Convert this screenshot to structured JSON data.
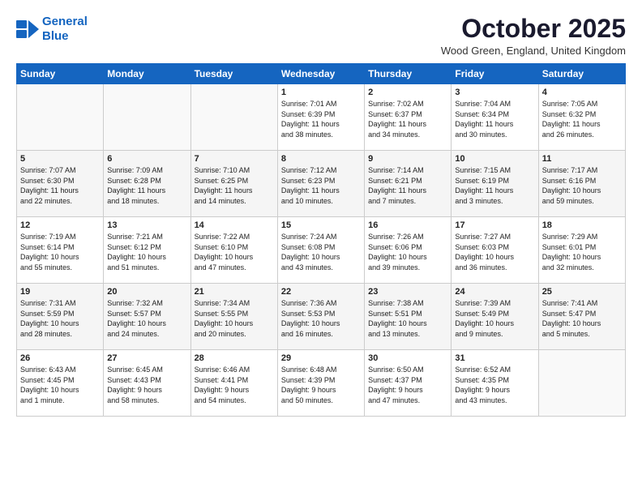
{
  "logo": {
    "text_general": "General",
    "text_blue": "Blue"
  },
  "title": "October 2025",
  "location": "Wood Green, England, United Kingdom",
  "weekdays": [
    "Sunday",
    "Monday",
    "Tuesday",
    "Wednesday",
    "Thursday",
    "Friday",
    "Saturday"
  ],
  "weeks": [
    [
      {
        "day": "",
        "info": ""
      },
      {
        "day": "",
        "info": ""
      },
      {
        "day": "",
        "info": ""
      },
      {
        "day": "1",
        "info": "Sunrise: 7:01 AM\nSunset: 6:39 PM\nDaylight: 11 hours\nand 38 minutes."
      },
      {
        "day": "2",
        "info": "Sunrise: 7:02 AM\nSunset: 6:37 PM\nDaylight: 11 hours\nand 34 minutes."
      },
      {
        "day": "3",
        "info": "Sunrise: 7:04 AM\nSunset: 6:34 PM\nDaylight: 11 hours\nand 30 minutes."
      },
      {
        "day": "4",
        "info": "Sunrise: 7:05 AM\nSunset: 6:32 PM\nDaylight: 11 hours\nand 26 minutes."
      }
    ],
    [
      {
        "day": "5",
        "info": "Sunrise: 7:07 AM\nSunset: 6:30 PM\nDaylight: 11 hours\nand 22 minutes."
      },
      {
        "day": "6",
        "info": "Sunrise: 7:09 AM\nSunset: 6:28 PM\nDaylight: 11 hours\nand 18 minutes."
      },
      {
        "day": "7",
        "info": "Sunrise: 7:10 AM\nSunset: 6:25 PM\nDaylight: 11 hours\nand 14 minutes."
      },
      {
        "day": "8",
        "info": "Sunrise: 7:12 AM\nSunset: 6:23 PM\nDaylight: 11 hours\nand 10 minutes."
      },
      {
        "day": "9",
        "info": "Sunrise: 7:14 AM\nSunset: 6:21 PM\nDaylight: 11 hours\nand 7 minutes."
      },
      {
        "day": "10",
        "info": "Sunrise: 7:15 AM\nSunset: 6:19 PM\nDaylight: 11 hours\nand 3 minutes."
      },
      {
        "day": "11",
        "info": "Sunrise: 7:17 AM\nSunset: 6:16 PM\nDaylight: 10 hours\nand 59 minutes."
      }
    ],
    [
      {
        "day": "12",
        "info": "Sunrise: 7:19 AM\nSunset: 6:14 PM\nDaylight: 10 hours\nand 55 minutes."
      },
      {
        "day": "13",
        "info": "Sunrise: 7:21 AM\nSunset: 6:12 PM\nDaylight: 10 hours\nand 51 minutes."
      },
      {
        "day": "14",
        "info": "Sunrise: 7:22 AM\nSunset: 6:10 PM\nDaylight: 10 hours\nand 47 minutes."
      },
      {
        "day": "15",
        "info": "Sunrise: 7:24 AM\nSunset: 6:08 PM\nDaylight: 10 hours\nand 43 minutes."
      },
      {
        "day": "16",
        "info": "Sunrise: 7:26 AM\nSunset: 6:06 PM\nDaylight: 10 hours\nand 39 minutes."
      },
      {
        "day": "17",
        "info": "Sunrise: 7:27 AM\nSunset: 6:03 PM\nDaylight: 10 hours\nand 36 minutes."
      },
      {
        "day": "18",
        "info": "Sunrise: 7:29 AM\nSunset: 6:01 PM\nDaylight: 10 hours\nand 32 minutes."
      }
    ],
    [
      {
        "day": "19",
        "info": "Sunrise: 7:31 AM\nSunset: 5:59 PM\nDaylight: 10 hours\nand 28 minutes."
      },
      {
        "day": "20",
        "info": "Sunrise: 7:32 AM\nSunset: 5:57 PM\nDaylight: 10 hours\nand 24 minutes."
      },
      {
        "day": "21",
        "info": "Sunrise: 7:34 AM\nSunset: 5:55 PM\nDaylight: 10 hours\nand 20 minutes."
      },
      {
        "day": "22",
        "info": "Sunrise: 7:36 AM\nSunset: 5:53 PM\nDaylight: 10 hours\nand 16 minutes."
      },
      {
        "day": "23",
        "info": "Sunrise: 7:38 AM\nSunset: 5:51 PM\nDaylight: 10 hours\nand 13 minutes."
      },
      {
        "day": "24",
        "info": "Sunrise: 7:39 AM\nSunset: 5:49 PM\nDaylight: 10 hours\nand 9 minutes."
      },
      {
        "day": "25",
        "info": "Sunrise: 7:41 AM\nSunset: 5:47 PM\nDaylight: 10 hours\nand 5 minutes."
      }
    ],
    [
      {
        "day": "26",
        "info": "Sunrise: 6:43 AM\nSunset: 4:45 PM\nDaylight: 10 hours\nand 1 minute."
      },
      {
        "day": "27",
        "info": "Sunrise: 6:45 AM\nSunset: 4:43 PM\nDaylight: 9 hours\nand 58 minutes."
      },
      {
        "day": "28",
        "info": "Sunrise: 6:46 AM\nSunset: 4:41 PM\nDaylight: 9 hours\nand 54 minutes."
      },
      {
        "day": "29",
        "info": "Sunrise: 6:48 AM\nSunset: 4:39 PM\nDaylight: 9 hours\nand 50 minutes."
      },
      {
        "day": "30",
        "info": "Sunrise: 6:50 AM\nSunset: 4:37 PM\nDaylight: 9 hours\nand 47 minutes."
      },
      {
        "day": "31",
        "info": "Sunrise: 6:52 AM\nSunset: 4:35 PM\nDaylight: 9 hours\nand 43 minutes."
      },
      {
        "day": "",
        "info": ""
      }
    ]
  ]
}
